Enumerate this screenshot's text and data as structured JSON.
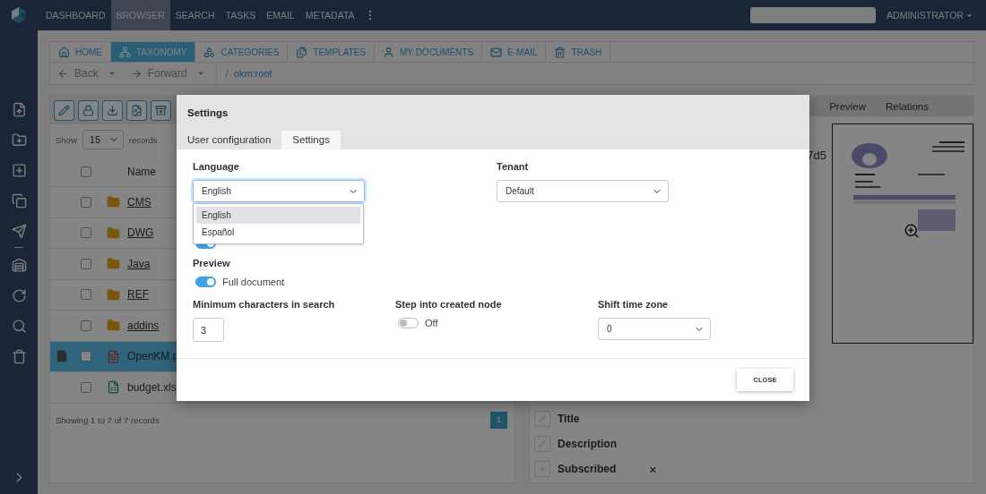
{
  "top_nav": {
    "items": [
      {
        "label": "DASHBOARD",
        "selected": false
      },
      {
        "label": "BROWSER",
        "selected": true
      },
      {
        "label": "SEARCH",
        "selected": false
      },
      {
        "label": "TASKS",
        "selected": false
      },
      {
        "label": "EMAIL",
        "selected": false
      },
      {
        "label": "METADATA",
        "selected": false
      }
    ],
    "user": "ADMINISTRATOR"
  },
  "section_tabs": [
    {
      "label": "HOME",
      "kind": "home",
      "selected": false
    },
    {
      "label": "TAXONOMY",
      "kind": "taxonomy",
      "selected": true
    },
    {
      "label": "CATEGORIES",
      "kind": "categories",
      "selected": false
    },
    {
      "label": "TEMPLATES",
      "kind": "templates",
      "selected": false
    },
    {
      "label": "MY DOCUMENTS",
      "kind": "user",
      "selected": false
    },
    {
      "label": "E-MAIL",
      "kind": "mail",
      "selected": false
    },
    {
      "label": "TRASH",
      "kind": "trash",
      "selected": false
    }
  ],
  "navigation": {
    "back": "Back",
    "forward": "Forward",
    "separator": "/",
    "path": "okm:root"
  },
  "file_list": {
    "show_label": "Show",
    "page_size": "15",
    "records_label": "records",
    "name_column": "Name",
    "all_checked": false,
    "rows": [
      {
        "name": "CMS",
        "kind": "folder",
        "checked": false,
        "selected": false
      },
      {
        "name": "DWG",
        "kind": "folder",
        "checked": false,
        "selected": false
      },
      {
        "name": "Java",
        "kind": "folder",
        "checked": false,
        "selected": false
      },
      {
        "name": "REF",
        "kind": "folder",
        "checked": false,
        "selected": false
      },
      {
        "name": "addins",
        "kind": "folder",
        "checked": false,
        "selected": false
      },
      {
        "name": "OpenKM.p",
        "kind": "pdf",
        "checked": false,
        "selected": true
      },
      {
        "name": "budget.xls",
        "kind": "spreadsheet",
        "checked": false,
        "selected": false
      }
    ],
    "footer": "Showing 1 to 7 of 7 records",
    "page": "1"
  },
  "details": {
    "tabs": [
      {
        "label": "Preview"
      },
      {
        "label": "Relations"
      }
    ],
    "fragment": "7d5",
    "properties": [
      {
        "label": "Title",
        "kind": "edit"
      },
      {
        "label": "Description",
        "kind": "edit"
      },
      {
        "label": "Subscribed",
        "kind": "add",
        "value": "×"
      }
    ]
  },
  "dialog": {
    "title": "Settings",
    "tabs": [
      {
        "label": "User configuration",
        "selected": false
      },
      {
        "label": "Settings",
        "selected": true
      }
    ],
    "language": {
      "label": "Language",
      "value": "English",
      "options": [
        {
          "label": "English",
          "selected": true
        },
        {
          "label": "Español",
          "selected": false
        }
      ]
    },
    "tenant": {
      "label": "Tenant",
      "value": "Default"
    },
    "hidden_toggle": {
      "on": true
    },
    "preview": {
      "label": "Preview",
      "on": true,
      "text": "Full document"
    },
    "min_chars": {
      "label": "Minimum characters in search",
      "value": "3"
    },
    "step_into": {
      "label": "Step into created node",
      "on": false,
      "text": "Off"
    },
    "time_zone": {
      "label": "Shift time zone",
      "value": "0"
    },
    "close": "CLOSE"
  }
}
